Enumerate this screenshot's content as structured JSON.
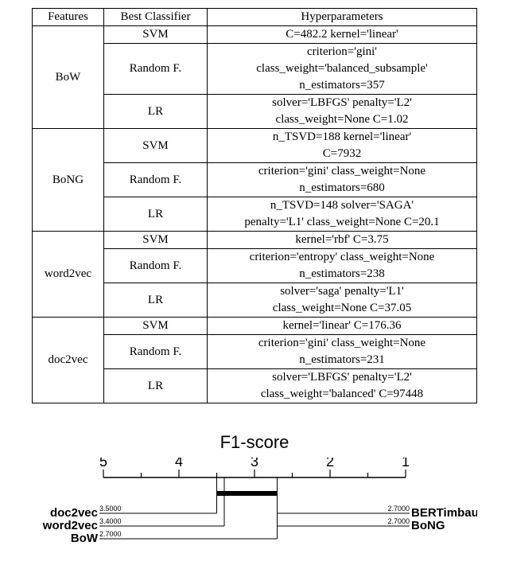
{
  "table": {
    "headers": [
      "Features",
      "Best Classifier",
      "Hyperparameters"
    ],
    "groups": [
      {
        "feature": "BoW",
        "rows": [
          {
            "classifier": "SVM",
            "hyper": [
              "C=482.2 kernel='linear'"
            ]
          },
          {
            "classifier": "Random F.",
            "hyper": [
              "criterion='gini'",
              "class_weight='balanced_subsample'",
              "n_estimators=357"
            ]
          },
          {
            "classifier": "LR",
            "hyper": [
              "solver='LBFGS' penalty='L2'",
              "class_weight=None C=1.02"
            ]
          }
        ]
      },
      {
        "feature": "BoNG",
        "rows": [
          {
            "classifier": "SVM",
            "hyper": [
              "n_TSVD=188 kernel='linear'",
              "C=7932"
            ]
          },
          {
            "classifier": "Random F.",
            "hyper": [
              "criterion='gini' class_weight=None",
              "n_estimators=680"
            ]
          },
          {
            "classifier": "LR",
            "hyper": [
              "n_TSVD=148 solver='SAGA'",
              "penalty='L1' class_weight=None C=20.1"
            ]
          }
        ]
      },
      {
        "feature": "word2vec",
        "rows": [
          {
            "classifier": "SVM",
            "hyper": [
              "kernel='rbf' C=3.75"
            ]
          },
          {
            "classifier": "Random F.",
            "hyper": [
              "criterion='entropy' class_weight=None",
              "n_estimators=238"
            ]
          },
          {
            "classifier": "LR",
            "hyper": [
              "solver='saga' penalty='L1'",
              "class_weight=None C=37.05"
            ]
          }
        ]
      },
      {
        "feature": "doc2vec",
        "rows": [
          {
            "classifier": "SVM",
            "hyper": [
              "kernel='linear' C=176.36"
            ]
          },
          {
            "classifier": "Random F.",
            "hyper": [
              "criterion='gini' class_weight=None",
              "n_estimators=231"
            ]
          },
          {
            "classifier": "LR",
            "hyper": [
              "solver='LBFGS' penalty='L2'",
              "class_weight='balanced' C=97448"
            ]
          }
        ]
      }
    ]
  },
  "chart_data": {
    "type": "cd_diagram",
    "title": "F1-score",
    "axis": {
      "min": 1,
      "max": 5,
      "ticks": [
        5,
        4,
        3,
        2,
        1
      ]
    },
    "crossbar": {
      "from": 2.7,
      "to": 3.5
    },
    "left": [
      {
        "name": "doc2vec",
        "score": 3.5,
        "score_label": "3.5000"
      },
      {
        "name": "word2vec",
        "score": 3.4,
        "score_label": "3.4000"
      },
      {
        "name": "BoW",
        "score": 2.7,
        "score_label": "2.7000"
      }
    ],
    "right": [
      {
        "name": "BERTimbau",
        "score": 2.7,
        "score_label": "2.7000"
      },
      {
        "name": "BoNG",
        "score": 2.7,
        "score_label": "2.7000"
      }
    ]
  }
}
